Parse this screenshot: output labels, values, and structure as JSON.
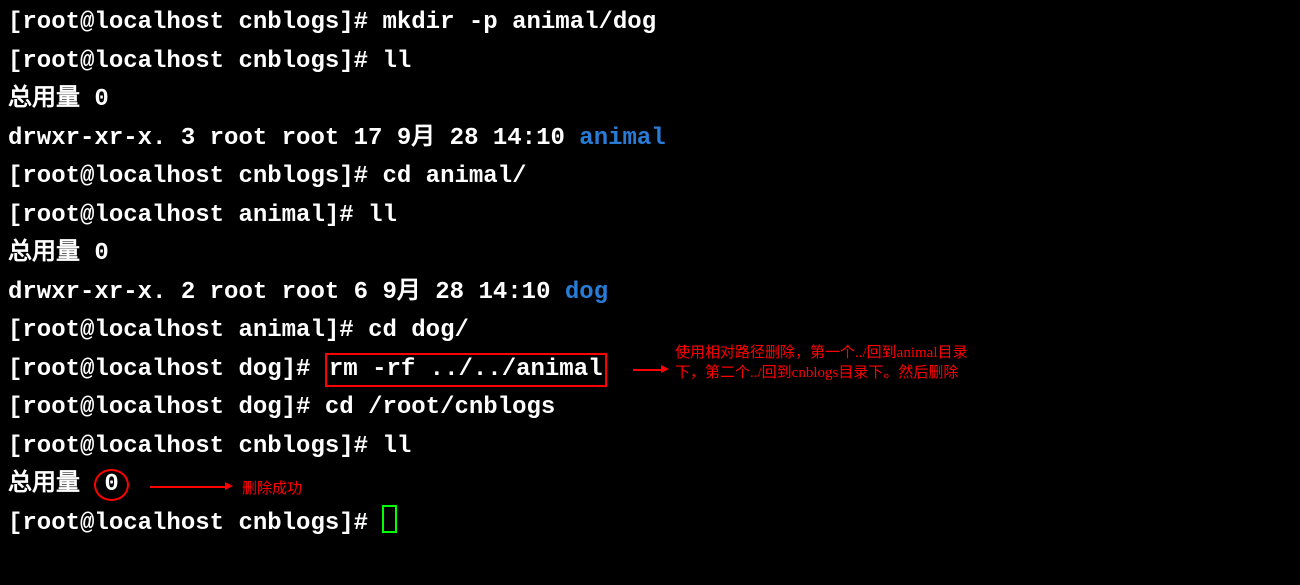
{
  "prompts": {
    "cnblogs": "[root@localhost cnblogs]# ",
    "animal": "[root@localhost animal]# ",
    "dog": "[root@localhost dog]# "
  },
  "cmds": {
    "mkdir": "mkdir -p animal/dog",
    "ll": "ll",
    "cd_animal": "cd animal/",
    "cd_dog": "cd dog/",
    "rm": "rm -rf ../../animal",
    "cd_root": "cd /root/cnblogs"
  },
  "output": {
    "total_label": "总用量 ",
    "total_zero": "0",
    "ls_animal_prefix": "drwxr-xr-x. 3 root root 17 9月  28 14:10 ",
    "ls_animal_dir": "animal",
    "ls_dog_prefix": "drwxr-xr-x. 2 root root 6 9月  28 14:10 ",
    "ls_dog_dir": "dog"
  },
  "annotations": {
    "rm_note": "使用相对路径删除，第一个../回到animal目录下，第二个../回到cnblogs目录下。然后删除",
    "success": "删除成功"
  }
}
